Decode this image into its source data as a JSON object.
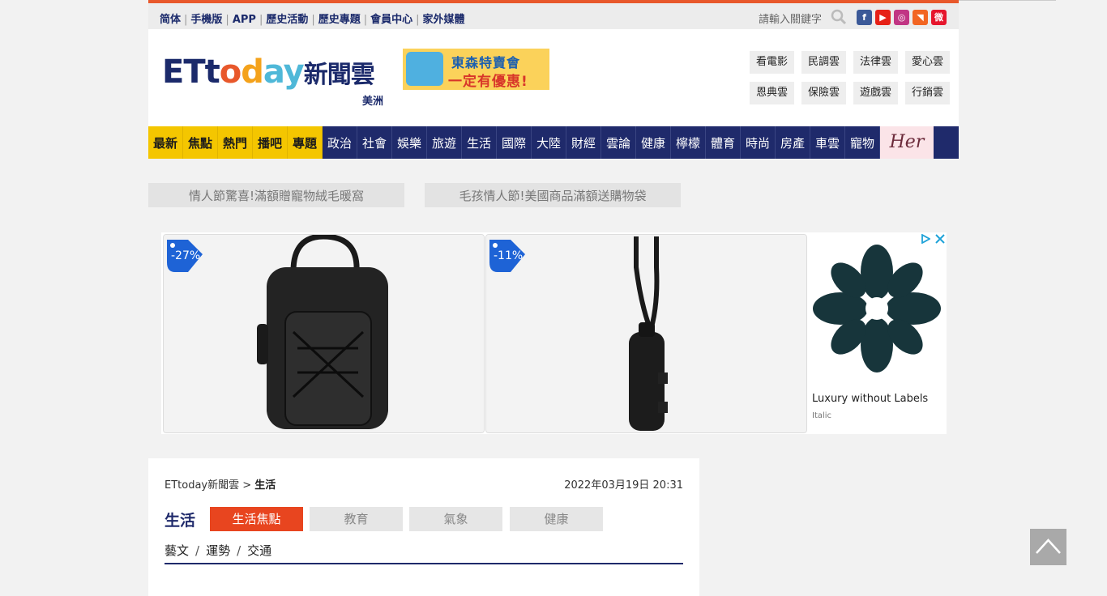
{
  "topbar": {
    "links": [
      "简体",
      "手機版",
      "APP",
      "歷史活動",
      "歷史專題",
      "會員中心",
      "家外媒體"
    ],
    "search_placeholder": "請輸入關鍵字",
    "social": [
      {
        "name": "facebook-icon",
        "glyph": "f",
        "color": "#3b5998"
      },
      {
        "name": "youtube-icon",
        "glyph": "▶",
        "color": "#e62117"
      },
      {
        "name": "instagram-icon",
        "glyph": "◎",
        "color": "#c13584"
      },
      {
        "name": "rss-icon",
        "glyph": "◥",
        "color": "#f26522"
      },
      {
        "name": "weibo-icon",
        "glyph": "微",
        "color": "#e6162d"
      }
    ]
  },
  "header": {
    "logo": {
      "e": "ET",
      "t": "t",
      "o": "o",
      "d": "d",
      "a": "ay",
      "cn": "新聞雲"
    },
    "region": "美洲",
    "banner": {
      "line1": "東森特賣會",
      "line2": "一定有優惠!"
    },
    "clouds": [
      "看電影",
      "民調雲",
      "法律雲",
      "愛心雲",
      "恩典雲",
      "保險雲",
      "遊戲雲",
      "行銷雲"
    ]
  },
  "nav": {
    "hot": [
      "最新",
      "焦點",
      "熱門",
      "播吧",
      "專題"
    ],
    "items": [
      "政治",
      "社會",
      "娛樂",
      "旅遊",
      "生活",
      "國際",
      "大陸",
      "財經",
      "雲論",
      "健康",
      "檸檬",
      "體育",
      "時尚",
      "房產",
      "車雲",
      "寵物"
    ],
    "her": "Her"
  },
  "promos": [
    "情人節驚喜!滿額贈寵物絨毛暖窩",
    "毛孩情人節!美國商品滿額送購物袋"
  ],
  "ad": {
    "card1_discount": "-27%",
    "card2_discount": "-11%",
    "side_title": "Luxury without Labels",
    "side_sub": "Italic"
  },
  "content": {
    "breadcrumb_home": "ETtoday新聞雲 >",
    "breadcrumb_current": "生活",
    "date": "2022年03月19日 20:31",
    "section_title": "生活",
    "subtabs": [
      "生活焦點",
      "教育",
      "氣象",
      "健康"
    ],
    "sublinks": [
      "藝文",
      "運勢",
      "交通"
    ]
  },
  "colors": {
    "navy": "#1f2a6b",
    "yellow": "#f4c600",
    "orange": "#e8451f"
  }
}
